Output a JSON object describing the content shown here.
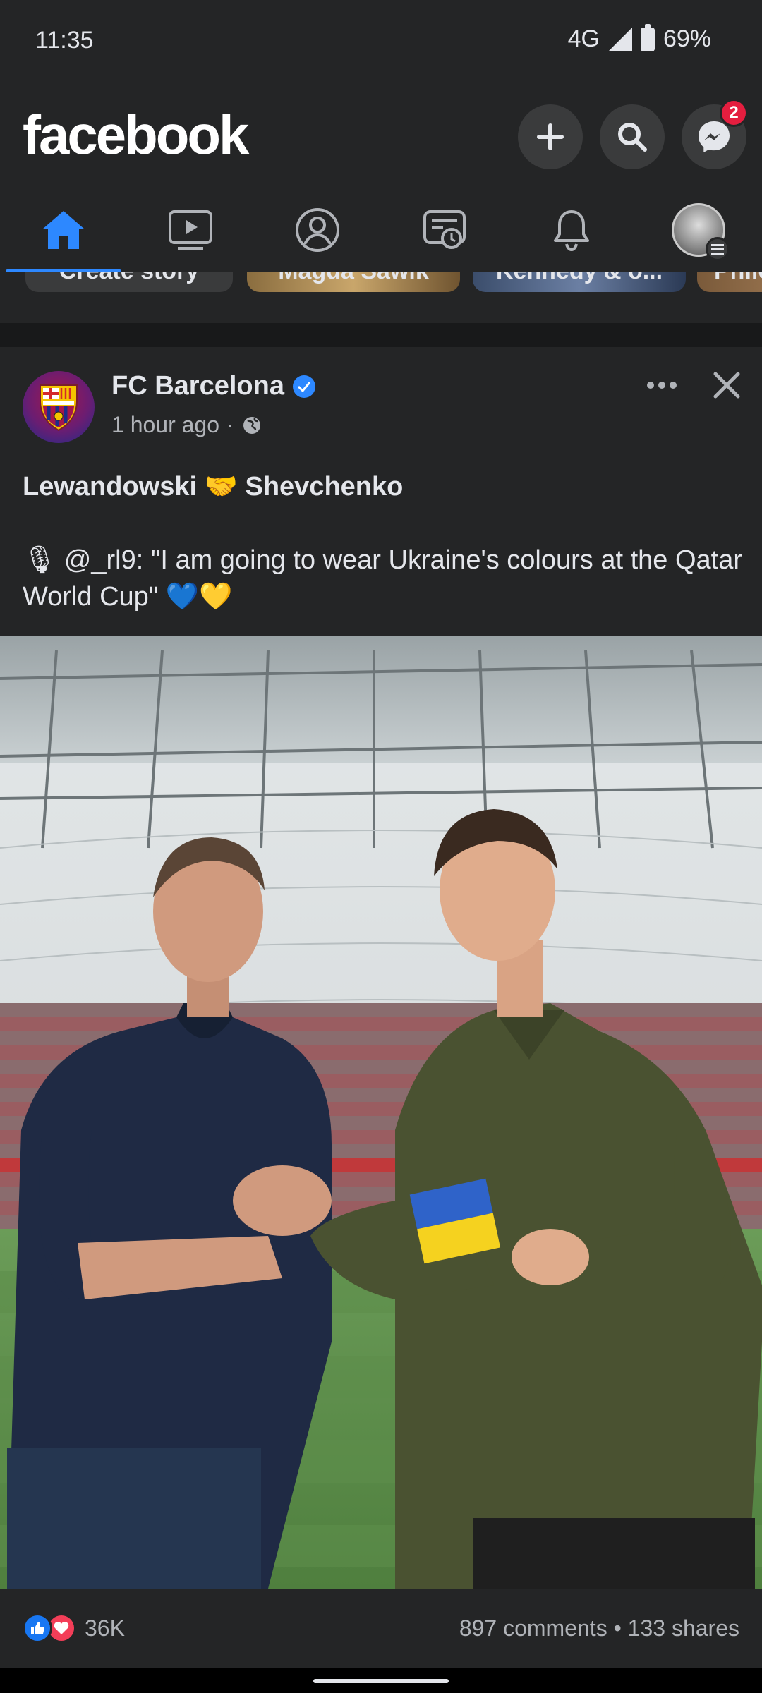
{
  "status_bar": {
    "time": "11:35",
    "network": "4G",
    "battery": "69%"
  },
  "header": {
    "logo": "facebook",
    "messenger_badge": "2"
  },
  "tabs": [
    {
      "name": "home",
      "active": true
    },
    {
      "name": "watch"
    },
    {
      "name": "profile"
    },
    {
      "name": "feeds"
    },
    {
      "name": "notifications"
    },
    {
      "name": "menu"
    }
  ],
  "stories": {
    "items": [
      "Create story",
      "Magda Sawik",
      "Kennedy & o...",
      "Philo"
    ]
  },
  "post": {
    "page_name": "FC Barcelona",
    "time": "1 hour ago",
    "title_line": "Lewandowski 🤝 Shevchenko",
    "body_line": "🎙 @_rl9: \"I am going to wear Ukraine's colours at the Qatar World Cup\" 💙💛",
    "reaction_count": "36K",
    "comments": "897 comments",
    "shares": "133 shares"
  },
  "colors": {
    "background": "#242526",
    "accent": "#2d88ff",
    "text": "#e4e6eb",
    "secondary_text": "#b0b3b8"
  }
}
